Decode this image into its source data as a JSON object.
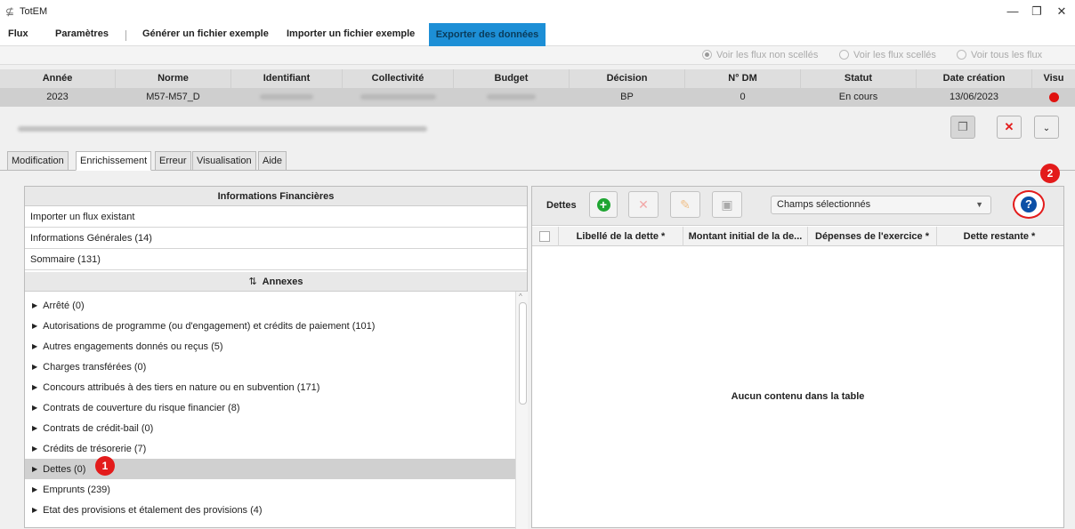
{
  "app": {
    "title": "TotEM",
    "icon": "totem-app-icon"
  },
  "menu": {
    "items": [
      "Flux",
      "Paramètres",
      "Générer un fichier exemple",
      "Importer un fichier exemple"
    ],
    "active": "Exporter des données"
  },
  "filters": {
    "options": [
      "Voir les flux non scellés",
      "Voir les flux scellés",
      "Voir tous les flux"
    ],
    "selected": "Voir les flux non scellés"
  },
  "flux_table": {
    "columns": [
      "Année",
      "Norme",
      "Identifiant",
      "Collectivité",
      "Budget",
      "Décision",
      "N° DM",
      "Statut",
      "Date création",
      "Visu"
    ],
    "row": {
      "annee": "2023",
      "norme": "M57-M57_D",
      "decision": "BP",
      "dm": "0",
      "statut": "En cours",
      "date": "13/06/2023",
      "visu_color": "#e0120f"
    }
  },
  "tabs": [
    "Modification",
    "Enrichissement",
    "Erreur",
    "Visualisation",
    "Aide"
  ],
  "active_tab": "Enrichissement",
  "left": {
    "header": "Informations Financières",
    "rows": [
      "Importer un flux existant",
      "Informations Générales (14)",
      "Sommaire (131)"
    ],
    "annexes_header": "Annexes",
    "annexes": [
      "Arrêté (0)",
      "Autorisations de programme (ou d'engagement) et crédits de paiement (101)",
      "Autres engagements donnés ou reçus (5)",
      "Charges transférées (0)",
      "Concours attribués à des tiers en nature ou en subvention (171)",
      "Contrats de couverture du risque financier (8)",
      "Contrats de crédit-bail (0)",
      "Crédits de trésorerie (7)",
      "Dettes (0)",
      "Emprunts (239)",
      "Etat des provisions et étalement des provisions (4)"
    ],
    "selected": "Dettes (0)"
  },
  "right": {
    "title": "Dettes",
    "fields_select": "Champs sélectionnés",
    "columns": [
      "Libellé de la dette *",
      "Montant initial de la de...",
      "Dépenses de l'exercice *",
      "Dette restante *"
    ],
    "empty": "Aucun contenu dans la table"
  },
  "badges": [
    "1",
    "2"
  ],
  "colors": {
    "accent": "#1d8fd6",
    "badge": "#e31b1b",
    "help": "#0b4fa6",
    "add": "#1fa532"
  }
}
